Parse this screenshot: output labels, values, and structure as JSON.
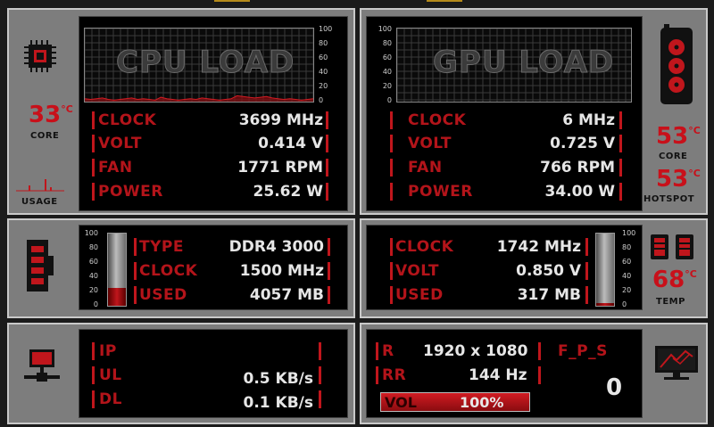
{
  "cpu": {
    "chart_title": "CPU LOAD",
    "axis_ticks": [
      "100",
      "80",
      "60",
      "40",
      "20",
      "0"
    ],
    "load_history": [
      4,
      3,
      4,
      5,
      3,
      2,
      3,
      4,
      5,
      3,
      4,
      3,
      2,
      6,
      4,
      3,
      2,
      3,
      4,
      3,
      5,
      4,
      3,
      2,
      3,
      4,
      8,
      7,
      6,
      5,
      6,
      7,
      5,
      4,
      3,
      4,
      3,
      2,
      3,
      4
    ],
    "rows": [
      {
        "label": "CLOCK",
        "value": "3699 MHz"
      },
      {
        "label": "VOLT",
        "value": "0.414 V"
      },
      {
        "label": "FAN",
        "value": "1771 RPM"
      },
      {
        "label": "POWER",
        "value": "25.62 W"
      }
    ],
    "temp": "33",
    "temp_unit": "°C",
    "core_label": "CORE",
    "usage_label": "USAGE"
  },
  "gpu": {
    "chart_title": "GPU LOAD",
    "axis_ticks": [
      "100",
      "80",
      "60",
      "40",
      "20",
      "0"
    ],
    "rows": [
      {
        "label": "CLOCK",
        "value": "6 MHz"
      },
      {
        "label": "VOLT",
        "value": "0.725 V"
      },
      {
        "label": "FAN",
        "value": "766 RPM"
      },
      {
        "label": "POWER",
        "value": "34.00 W"
      }
    ],
    "core_temp": "53",
    "hotspot_temp": "53",
    "temp_unit": "°C",
    "core_label": "CORE",
    "hotspot_label": "HOTSPOT"
  },
  "ram": {
    "axis_ticks": [
      "100",
      "80",
      "60",
      "40",
      "20",
      "0"
    ],
    "usage_fraction": 0.25,
    "rows": [
      {
        "label": "TYPE",
        "value": "DDR4 3000"
      },
      {
        "label": "CLOCK",
        "value": "1500 MHz"
      },
      {
        "label": "USED",
        "value": "4057 MB"
      }
    ]
  },
  "vram": {
    "axis_ticks": [
      "100",
      "80",
      "60",
      "40",
      "20",
      "0"
    ],
    "usage_fraction": 0.04,
    "rows": [
      {
        "label": "CLOCK",
        "value": "1742 MHz"
      },
      {
        "label": "VOLT",
        "value": "0.850 V"
      },
      {
        "label": "USED",
        "value": "317 MB"
      }
    ],
    "temp": "68",
    "temp_unit": "°C",
    "temp_label": "TEMP"
  },
  "network": {
    "rows": [
      {
        "label": "IP",
        "value": ""
      },
      {
        "label": "UL",
        "value": "0.5 KB/s"
      },
      {
        "label": "DL",
        "value": "0.1 KB/s"
      }
    ]
  },
  "display": {
    "res_label": "R",
    "res_value": "1920 x 1080",
    "rr_label": "RR",
    "rr_value": "144 Hz",
    "vol_label": "VOL",
    "vol_value": "100%",
    "vol_fraction": 1.0,
    "fps_label": "F_P_S",
    "fps_value": "0"
  },
  "colors": {
    "accent": "#c0161c",
    "panel": "#7d7d7d",
    "background": "#000000"
  }
}
